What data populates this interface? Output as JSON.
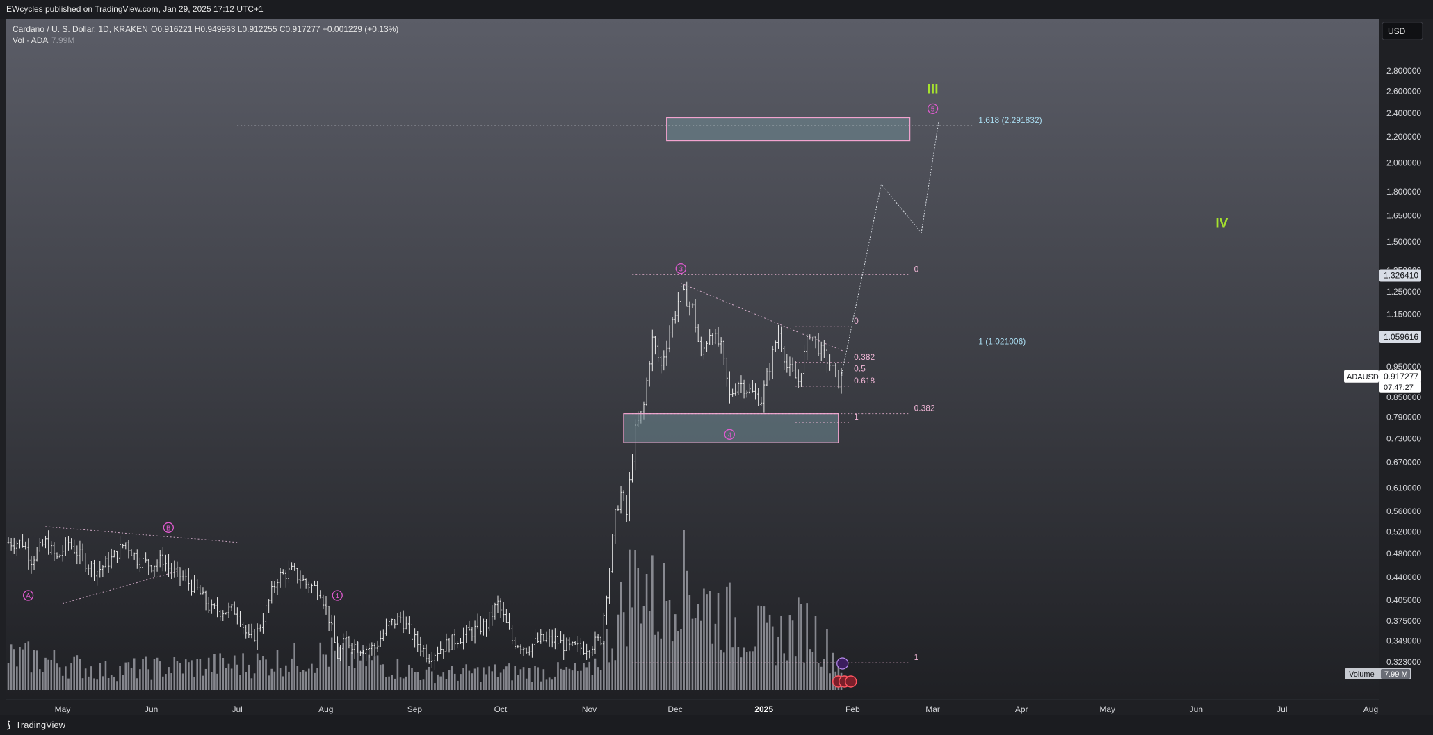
{
  "header": {
    "published": "EWcycles published on TradingView.com, Jan 29, 2025 17:12 UTC+1"
  },
  "footer": {
    "brand": "TradingView"
  },
  "legend": {
    "symbol_line": "Cardano / U. S. Dollar, 1D, KRAKEN",
    "ohlc": "O0.916221  H0.949963  L0.912255  C0.917277  +0.001229 (+0.13%)",
    "vol_label": "Vol · ADA",
    "vol_value": "7.99M"
  },
  "currency_button": "USD",
  "colors": {
    "background_top": "#5b5d67",
    "background_bottom": "#1f2024",
    "candle": "#e8e8e8",
    "volume": "#a8aab1",
    "wave_label": "#e05bd0",
    "fib_label": "#f0b6d6",
    "fib_blue": "#a9dcf0",
    "degree_label": "#a6e22e",
    "zone_fill": "#6f8a94",
    "zone_border": "#f3a3cf"
  },
  "chart_data": {
    "type": "candlestick",
    "title": "Cardano / U. S. Dollar, 1D, KRAKEN",
    "y_scale": "log",
    "ylim": [
      0.3,
      3.0
    ],
    "y_ticks": [
      "2.800000",
      "2.600000",
      "2.400000",
      "2.200000",
      "2.000000",
      "1.800000",
      "1.650000",
      "1.500000",
      "1.350000",
      "1.250000",
      "1.150000",
      "1.050000",
      "0.950000",
      "0.850000",
      "0.790000",
      "0.730000",
      "0.670000",
      "0.610000",
      "0.560000",
      "0.520000",
      "0.480000",
      "0.440000",
      "0.405000",
      "0.375000",
      "0.349000",
      "0.323000"
    ],
    "x_ticks": [
      "May",
      "Jun",
      "Jul",
      "Aug",
      "Sep",
      "Oct",
      "Nov",
      "Dec",
      "2025",
      "Feb",
      "Mar",
      "Apr",
      "May",
      "Jun",
      "Jul",
      "Aug"
    ],
    "x_tick_dates": [
      "2024-05-01",
      "2024-06-01",
      "2024-07-01",
      "2024-08-01",
      "2024-09-01",
      "2024-10-01",
      "2024-11-01",
      "2024-12-01",
      "2025-01-01",
      "2025-02-01",
      "2025-03-01",
      "2025-04-01",
      "2025-05-01",
      "2025-06-01",
      "2025-07-01",
      "2025-08-01"
    ],
    "price_path": [
      [
        "2024-04-17",
        0.5
      ],
      [
        "2024-04-20",
        0.47
      ],
      [
        "2024-04-25",
        0.5
      ],
      [
        "2024-04-29",
        0.47
      ],
      [
        "2024-05-03",
        0.5
      ],
      [
        "2024-05-08",
        0.47
      ],
      [
        "2024-05-13",
        0.45
      ],
      [
        "2024-05-18",
        0.47
      ],
      [
        "2024-05-23",
        0.5
      ],
      [
        "2024-05-27",
        0.47
      ],
      [
        "2024-06-01",
        0.46
      ],
      [
        "2024-06-05",
        0.47
      ],
      [
        "2024-06-08",
        0.45
      ],
      [
        "2024-06-12",
        0.44
      ],
      [
        "2024-06-17",
        0.42
      ],
      [
        "2024-06-22",
        0.39
      ],
      [
        "2024-06-27",
        0.39
      ],
      [
        "2024-07-01",
        0.39
      ],
      [
        "2024-07-05",
        0.35
      ],
      [
        "2024-07-08",
        0.36
      ],
      [
        "2024-07-11",
        0.39
      ],
      [
        "2024-07-15",
        0.44
      ],
      [
        "2024-07-20",
        0.45
      ],
      [
        "2024-07-25",
        0.43
      ],
      [
        "2024-07-30",
        0.42
      ],
      [
        "2024-08-02",
        0.38
      ],
      [
        "2024-08-05",
        0.33
      ],
      [
        "2024-08-08",
        0.35
      ],
      [
        "2024-08-13",
        0.34
      ],
      [
        "2024-08-18",
        0.34
      ],
      [
        "2024-08-23",
        0.37
      ],
      [
        "2024-08-27",
        0.38
      ],
      [
        "2024-09-01",
        0.35
      ],
      [
        "2024-09-06",
        0.33
      ],
      [
        "2024-09-10",
        0.34
      ],
      [
        "2024-09-15",
        0.35
      ],
      [
        "2024-09-20",
        0.36
      ],
      [
        "2024-09-26",
        0.37
      ],
      [
        "2024-09-30",
        0.4
      ],
      [
        "2024-10-05",
        0.35
      ],
      [
        "2024-10-10",
        0.34
      ],
      [
        "2024-10-15",
        0.35
      ],
      [
        "2024-10-20",
        0.35
      ],
      [
        "2024-10-25",
        0.34
      ],
      [
        "2024-10-30",
        0.34
      ],
      [
        "2024-11-05",
        0.35
      ],
      [
        "2024-11-08",
        0.45
      ],
      [
        "2024-11-10",
        0.55
      ],
      [
        "2024-11-12",
        0.6
      ],
      [
        "2024-11-14",
        0.55
      ],
      [
        "2024-11-17",
        0.75
      ],
      [
        "2024-11-20",
        0.82
      ],
      [
        "2024-11-23",
        1.05
      ],
      [
        "2024-11-26",
        0.95
      ],
      [
        "2024-11-30",
        1.12
      ],
      [
        "2024-12-03",
        1.25
      ],
      [
        "2024-12-07",
        1.18
      ],
      [
        "2024-12-10",
        0.98
      ],
      [
        "2024-12-13",
        1.08
      ],
      [
        "2024-12-17",
        1.02
      ],
      [
        "2024-12-20",
        0.85
      ],
      [
        "2024-12-23",
        0.9
      ],
      [
        "2024-12-27",
        0.87
      ],
      [
        "2024-12-31",
        0.84
      ],
      [
        "2025-01-03",
        0.95
      ],
      [
        "2025-01-06",
        1.08
      ],
      [
        "2025-01-09",
        0.95
      ],
      [
        "2025-01-13",
        0.9
      ],
      [
        "2025-01-17",
        1.08
      ],
      [
        "2025-01-20",
        1.02
      ],
      [
        "2025-01-24",
        0.96
      ],
      [
        "2025-01-27",
        0.9
      ],
      [
        "2025-01-29",
        0.917
      ]
    ],
    "volume_scale_max": 100,
    "volume_samples": [
      [
        "2024-04-20",
        25
      ],
      [
        "2024-05-15",
        15
      ],
      [
        "2024-06-10",
        18
      ],
      [
        "2024-07-05",
        20
      ],
      [
        "2024-08-05",
        28
      ],
      [
        "2024-09-05",
        12
      ],
      [
        "2024-10-01",
        14
      ],
      [
        "2024-11-01",
        14
      ],
      [
        "2024-11-10",
        45
      ],
      [
        "2024-11-15",
        80
      ],
      [
        "2024-11-20",
        90
      ],
      [
        "2024-11-25",
        60
      ],
      [
        "2024-12-03",
        100
      ],
      [
        "2024-12-10",
        70
      ],
      [
        "2024-12-20",
        55
      ],
      [
        "2025-01-03",
        40
      ],
      [
        "2025-01-17",
        50
      ],
      [
        "2025-01-29",
        15
      ]
    ],
    "projection": [
      [
        "2025-01-28",
        0.917
      ],
      [
        "2025-02-11",
        1.85
      ],
      [
        "2025-02-25",
        1.55
      ],
      [
        "2025-03-03",
        2.32
      ]
    ],
    "price_labels": [
      {
        "name": "last-price",
        "text": "1.326410",
        "value": 1.32641,
        "style": "light"
      },
      {
        "name": "level-price",
        "text": "1.059616",
        "value": 1.059616,
        "style": "light"
      },
      {
        "name": "current-price",
        "text": "0.917277",
        "value": 0.917277,
        "style": "current"
      }
    ],
    "current_symbol": "ADAUSD",
    "countdown": "07:47:27",
    "volume_badge": {
      "label": "Volume",
      "value": "7.99 M"
    },
    "zones": [
      {
        "name": "target-zone",
        "x0": "2024-11-28",
        "x1": "2025-02-21",
        "y0": 2.17,
        "y1": 2.36
      },
      {
        "name": "support-zone",
        "x0": "2024-11-13",
        "x1": "2025-01-27",
        "y0": 0.72,
        "y1": 0.8
      }
    ],
    "fib_levels": [
      {
        "name": "fib-1618",
        "text": "1.618 (2.291832)",
        "value": 2.291832,
        "x0": "2024-07-01",
        "x1": "2025-03-15",
        "color": "blue"
      },
      {
        "name": "fib-1",
        "text": "1 (1.021006)",
        "value": 1.021006,
        "x0": "2024-07-01",
        "x1": "2025-03-15",
        "color": "blue"
      },
      {
        "name": "fib-0-big",
        "text": "0",
        "value": 1.33,
        "x0": "2024-11-16",
        "x1": "2025-02-21",
        "color": "pink"
      },
      {
        "name": "fib-0382-big",
        "text": "0.382",
        "value": 0.8,
        "x0": "2024-11-16",
        "x1": "2025-02-21",
        "color": "pink"
      },
      {
        "name": "fib-1-big",
        "text": "1",
        "value": 0.322,
        "x0": "2024-11-16",
        "x1": "2025-02-21",
        "color": "pink"
      },
      {
        "name": "fib-0-small",
        "text": "0",
        "value": 1.1,
        "x0": "2025-01-12",
        "x1": "2025-01-31",
        "color": "pink"
      },
      {
        "name": "fib-0382-small",
        "text": "0.382",
        "value": 0.965,
        "x0": "2025-01-12",
        "x1": "2025-01-31",
        "color": "pink"
      },
      {
        "name": "fib-05-small",
        "text": "0.5",
        "value": 0.925,
        "x0": "2025-01-12",
        "x1": "2025-01-31",
        "color": "pink"
      },
      {
        "name": "fib-0618-small",
        "text": "0.618",
        "value": 0.885,
        "x0": "2025-01-12",
        "x1": "2025-01-31",
        "color": "pink"
      },
      {
        "name": "fib-1-small",
        "text": "1",
        "value": 0.775,
        "x0": "2025-01-12",
        "x1": "2025-01-31",
        "color": "pink"
      }
    ],
    "wave_labels": [
      {
        "name": "wave-A",
        "text": "A",
        "x": "2024-04-19",
        "y": 0.412
      },
      {
        "name": "wave-B",
        "text": "B",
        "x": "2024-06-07",
        "y": 0.528
      },
      {
        "name": "wave-1",
        "text": "1",
        "x": "2024-08-05",
        "y": 0.412
      },
      {
        "name": "wave-3",
        "text": "3",
        "x": "2024-12-03",
        "y": 1.36
      },
      {
        "name": "wave-4",
        "text": "4",
        "x": "2024-12-20",
        "y": 0.742
      },
      {
        "name": "wave-5",
        "text": "5",
        "x": "2025-03-01",
        "y": 2.44
      }
    ],
    "degree_labels": [
      {
        "name": "degree-III",
        "text": "III",
        "x": "2025-03-01",
        "y": 2.58
      },
      {
        "name": "degree-IV",
        "text": "IV",
        "x": "2025-06-10",
        "y": 1.58
      }
    ],
    "trendlines": [
      {
        "name": "triangle-upper",
        "x0": "2024-04-25",
        "y0": 0.53,
        "x1": "2024-07-01",
        "y1": 0.5
      },
      {
        "name": "triangle-lower",
        "x0": "2024-05-01",
        "y0": 0.4,
        "x1": "2024-06-10",
        "y1": 0.45
      },
      {
        "name": "wedge-upper",
        "x0": "2024-12-03",
        "y0": 1.29,
        "x1": "2025-01-29",
        "y1": 1.005
      }
    ]
  }
}
